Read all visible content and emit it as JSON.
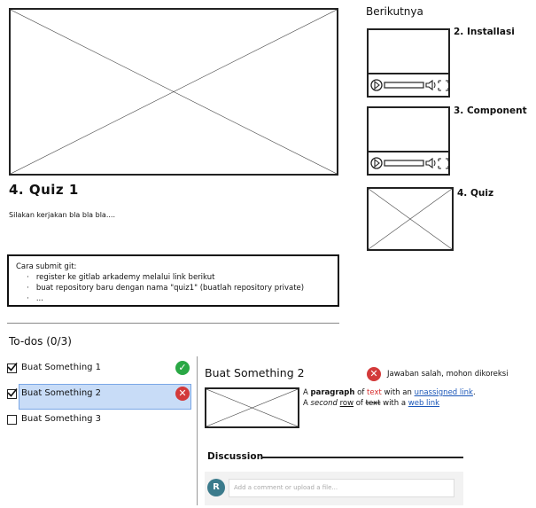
{
  "main_video": {},
  "quiz": {
    "title": "4. Quiz 1",
    "description": "Silakan kerjakan bla bla bla....",
    "submit_heading": "Cara submit git:",
    "steps": [
      "register ke gitlab arkademy melalui link berikut",
      "buat repository baru dengan nama \"quiz1\" (buatlah repository private)",
      "..."
    ]
  },
  "sidebar": {
    "title": "Berikutnya",
    "items": [
      {
        "label": "2. Installasi",
        "type": "video"
      },
      {
        "label": "3. Component",
        "type": "video"
      },
      {
        "label": "4. Quiz",
        "type": "image"
      }
    ]
  },
  "todos": {
    "title": "To-dos (0/3)",
    "items": [
      {
        "label": "Buat Something 1",
        "checked": true,
        "status": "success",
        "selected": false
      },
      {
        "label": "Buat Something 2",
        "checked": true,
        "status": "error",
        "selected": true
      },
      {
        "label": "Buat Something 3",
        "checked": false,
        "status": "none",
        "selected": false
      }
    ]
  },
  "detail": {
    "title": "Buat Something 2",
    "error_message": "Jawaban salah, mohon dikoreksi",
    "line1": {
      "pre": "A ",
      "bold": "paragraph",
      "mid1": " of ",
      "red": "text",
      "mid2": " with an ",
      "link": "unassigned link",
      "post": "."
    },
    "line2": {
      "pre": "A ",
      "italic": "second",
      "mid1": " ",
      "underline": "row",
      "mid2": " of ",
      "strike": "text",
      "mid3": " with a ",
      "link": "web link"
    }
  },
  "discussion": {
    "title": "Discussion",
    "avatar_initial": "R",
    "comment_placeholder": "Add a comment or upload a file..."
  },
  "colors": {
    "success": "#2aa845",
    "error": "#d33a3a",
    "selected_bg": "#c8dcf7",
    "selected_border": "#7aa7e6",
    "link": "#1a56b8",
    "avatar": "#3b7b8c"
  }
}
